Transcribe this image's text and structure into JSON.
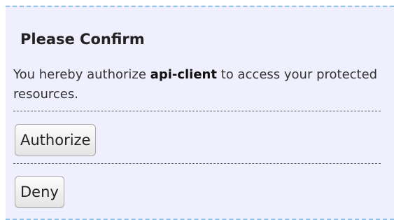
{
  "confirm": {
    "title": "Please Confirm",
    "message_prefix": "You hereby authorize ",
    "client_name": "api-client",
    "message_suffix": " to access your protected resources.",
    "authorize_label": "Authorize",
    "deny_label": "Deny"
  },
  "colors": {
    "panel_background": "#efeffd",
    "panel_border": "#8fc2e6"
  }
}
